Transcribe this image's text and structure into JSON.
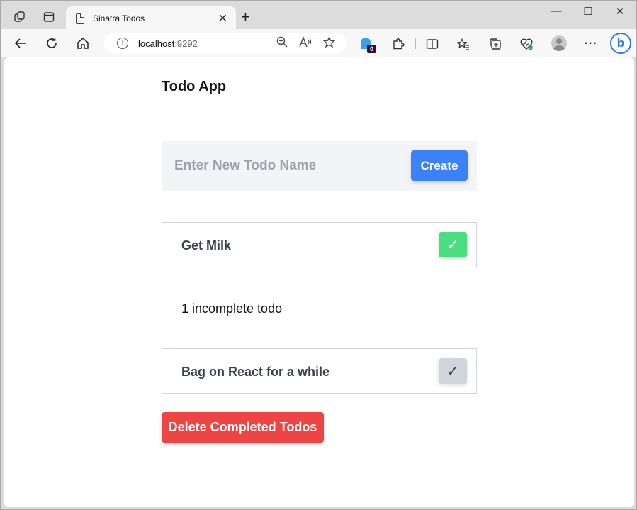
{
  "browser": {
    "tab_title": "Sinatra Todos",
    "tab_close": "✕",
    "new_tab": "+",
    "url_host": "localhost",
    "url_port": ":9292",
    "window_controls": {
      "minimize": "—",
      "maximize": "☐",
      "close": "✕"
    },
    "extension_badge": "0",
    "more_label": "···",
    "bing_label": "b"
  },
  "icons": {
    "workspaces": "workspaces-icon",
    "tab_actions": "tab-actions-icon",
    "back": "back-arrow-icon",
    "refresh": "refresh-icon",
    "home": "home-icon",
    "info": "info-icon",
    "zoom": "zoom-icon",
    "read_aloud": "read-aloud-icon",
    "favorite": "star-icon",
    "extensions": "puzzle-icon",
    "split_screen": "split-screen-icon",
    "favorites": "favorites-icon",
    "collections": "collections-icon",
    "browser_essentials": "heart-pulse-icon",
    "profile": "avatar",
    "more": "more-icon",
    "copilot": "bing-icon"
  },
  "app": {
    "title": "Todo App",
    "new_todo_placeholder": "Enter New Todo Name",
    "create_label": "Create",
    "incomplete_count_text": "1 incomplete todo",
    "delete_completed_label": "Delete Completed Todos"
  },
  "todos": [
    {
      "name": "Get Milk",
      "completed": false,
      "check_glyph": "✓"
    },
    {
      "name": "Bag on React for a while",
      "completed": true,
      "check_glyph": "✓"
    }
  ],
  "colors": {
    "primary_blue": "#3b82f6",
    "check_green": "#4ade80",
    "check_grey": "#d1d5db",
    "danger_red": "#ef4444"
  }
}
